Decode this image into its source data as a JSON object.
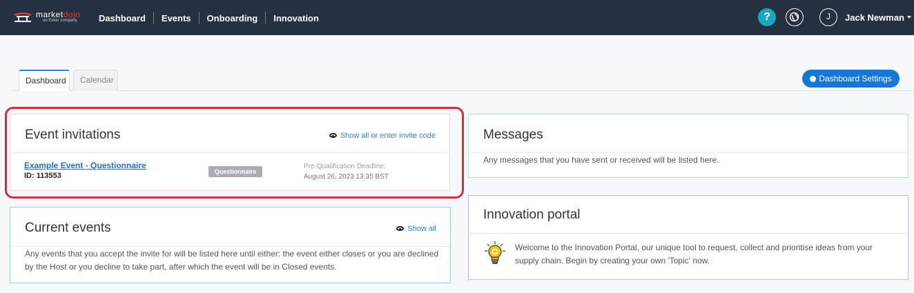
{
  "brand": {
    "logo_text_a": "market",
    "logo_text_b": "dojo",
    "logo_sub": "an Esker company"
  },
  "nav": {
    "links": [
      "Dashboard",
      "Events",
      "Onboarding",
      "Innovation"
    ]
  },
  "header": {
    "help_label": "?",
    "avatar_initial": "J",
    "user_name": "Jack Newman"
  },
  "tabs": [
    {
      "label": "Dashboard",
      "active": true
    },
    {
      "label": "Calendar",
      "active": false
    }
  ],
  "dashboard_settings_label": "Dashboard Settings",
  "event_invitations": {
    "title": "Event invitations",
    "link": "Show all or enter invite code",
    "event": {
      "name": "Example Event - Questionnaire",
      "id": "ID: 113553",
      "badge": "Questionnaire",
      "deadline_label": "Pre-Qualification Deadline:",
      "deadline_value": "August 26, 2023 13:35 BST"
    }
  },
  "current_events": {
    "title": "Current events",
    "link": "Show all",
    "text": "Any events that you accept the invite for will be listed here until either: the event either closes or you are declined by the Host or you decline to take part, after which the event will be in Closed events."
  },
  "messages": {
    "title": "Messages",
    "text": "Any messages that you have sent or received will be listed here."
  },
  "innovation": {
    "title": "Innovation portal",
    "text": "Welcome to the Innovation Portal, our unique tool to request, collect and prioritise ideas from your supply chain. Begin by creating your own 'Topic' now."
  },
  "colors": {
    "nav_bg": "#253140",
    "help_bg": "#19a7bf",
    "primary": "#1577d6",
    "highlight": "#e3243a",
    "current_events_border": "#9fcdf3",
    "messages_border": "#b7e6b9",
    "innovation_border": "#f3b2b2"
  },
  "icons": [
    "logo-icon",
    "help-icon",
    "globe-icon",
    "caret-down-icon",
    "gear-icon",
    "eye-icon",
    "lightbulb-icon"
  ]
}
